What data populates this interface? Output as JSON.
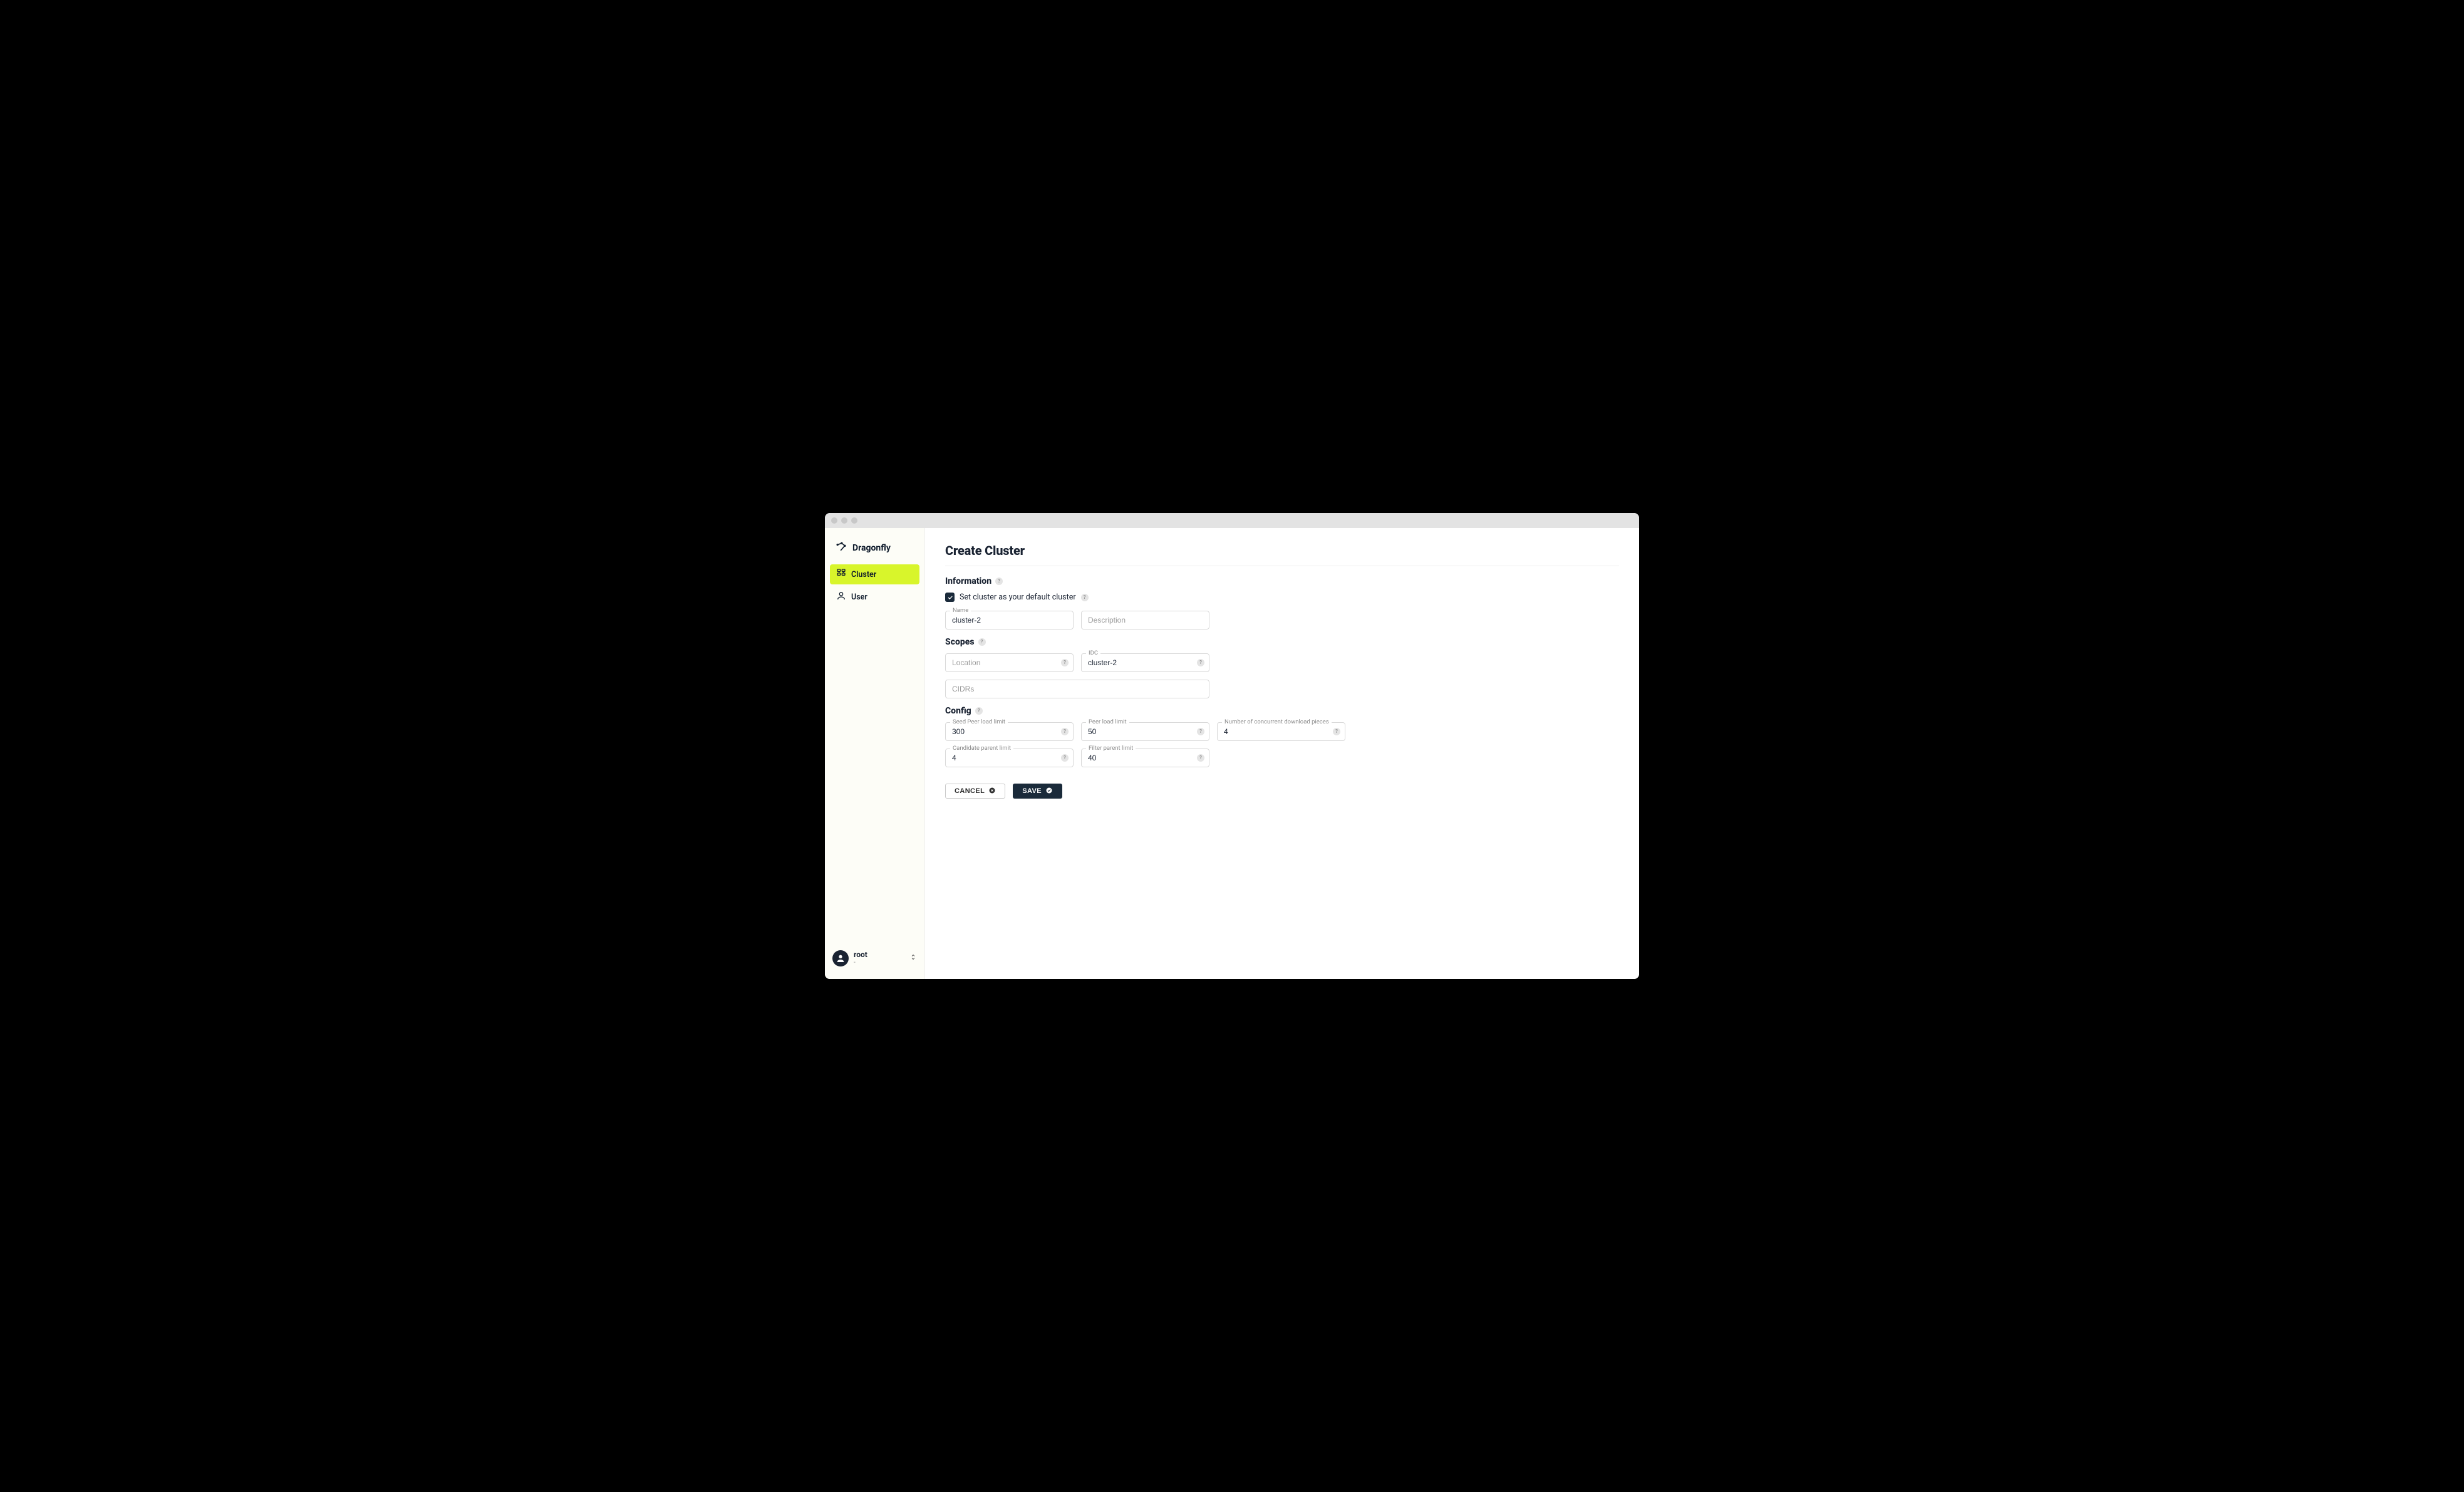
{
  "brand": {
    "name": "Dragonfly"
  },
  "sidebar": {
    "items": [
      {
        "label": "Cluster",
        "active": true
      },
      {
        "label": "User",
        "active": false
      }
    ]
  },
  "user": {
    "name": "root",
    "sub": "-"
  },
  "page": {
    "title": "Create Cluster"
  },
  "sections": {
    "information": {
      "title": "Information",
      "default_cluster_label": "Set cluster as your default cluster",
      "default_cluster_checked": true,
      "name": {
        "label": "Name",
        "value": "cluster-2"
      },
      "description": {
        "placeholder": "Description",
        "value": ""
      }
    },
    "scopes": {
      "title": "Scopes",
      "location": {
        "placeholder": "Location",
        "value": ""
      },
      "idc": {
        "label": "IDC",
        "value": "cluster-2"
      },
      "cidrs": {
        "placeholder": "CIDRs",
        "value": ""
      }
    },
    "config": {
      "title": "Config",
      "seed_peer_load_limit": {
        "label": "Seed Peer load limit",
        "value": "300"
      },
      "peer_load_limit": {
        "label": "Peer load limit",
        "value": "50"
      },
      "concurrent_pieces": {
        "label": "Number of concurrent download pieces",
        "value": "4"
      },
      "candidate_parent_limit": {
        "label": "Candidate parent limit",
        "value": "4"
      },
      "filter_parent_limit": {
        "label": "Filter parent limit",
        "value": "40"
      }
    }
  },
  "buttons": {
    "cancel": "CANCEL",
    "save": "SAVE"
  }
}
